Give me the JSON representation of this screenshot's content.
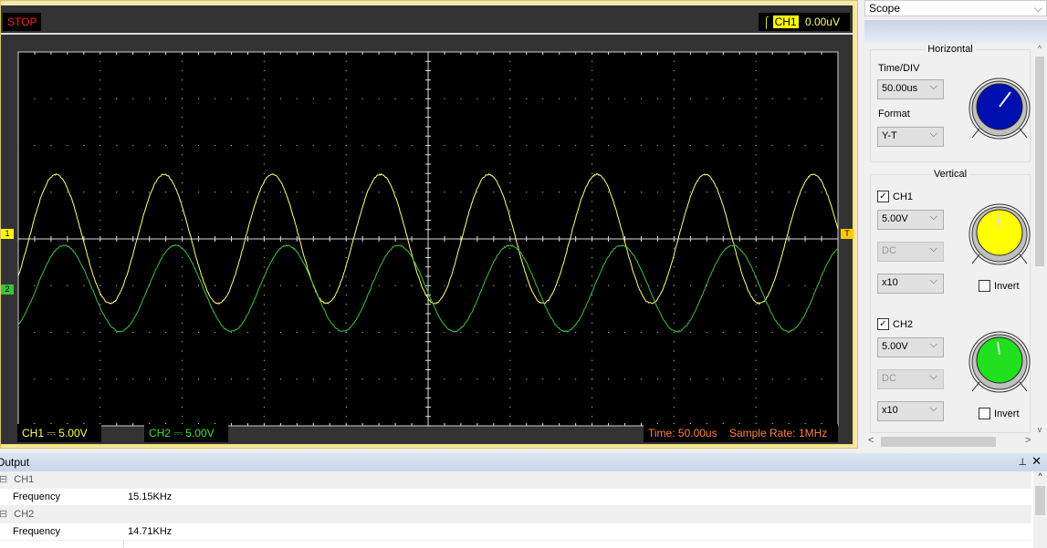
{
  "scope": {
    "status": "STOP",
    "trigger": {
      "icon": "rising-edge-trigger-icon",
      "channel": "CH1",
      "level": "0.00uV"
    },
    "ch1_label": "CH1",
    "ch1_coupling_icon": "dc-coupling-icon",
    "ch1_scale": "5.00V",
    "ch2_label": "CH2",
    "ch2_scale": "5.00V",
    "time_label": "Time: 50.00us",
    "sample_rate": "Sample Rate: 1MHz",
    "markers": {
      "ch1": "1",
      "ch2": "2",
      "trigger": "T"
    },
    "colors": {
      "ch1": "#ffff80",
      "ch2": "#40c040",
      "background": "#000000",
      "grid": "#bbbbbb",
      "status": "#ff2020",
      "info": "#ff8040"
    }
  },
  "chart_data": {
    "type": "line",
    "x_unit": "us",
    "xlim": [
      0,
      500
    ],
    "x_divisions": 10,
    "y_unit": "V",
    "ylim": [
      -20,
      20
    ],
    "y_divisions": 8,
    "grid": true,
    "series": [
      {
        "name": "CH1",
        "color": "#ffff80",
        "waveform": "sine",
        "frequency_khz": 15.15,
        "amplitude_v": 6.9,
        "offset_v": 0,
        "first_peak_us": 23
      },
      {
        "name": "CH2",
        "color": "#40c040",
        "waveform": "sine",
        "frequency_khz": 14.71,
        "amplitude_v": 4.6,
        "offset_v": -5.3,
        "first_peak_us": 28
      }
    ]
  },
  "panel": {
    "title": "Scope",
    "horizontal": {
      "title": "Horizontal",
      "time_div_label": "Time/DIV",
      "time_div": "50.00us",
      "format_label": "Format",
      "format": "Y-T",
      "knob_color": "#0010b0"
    },
    "vertical": {
      "title": "Vertical",
      "ch1": {
        "label": "CH1",
        "checked": true,
        "volts": "5.00V",
        "coupling": "DC",
        "probe": "x10",
        "invert": "Invert",
        "knob_color": "#ffff00"
      },
      "ch2": {
        "label": "CH2",
        "checked": true,
        "volts": "5.00V",
        "coupling": "DC",
        "probe": "x10",
        "invert": "Invert",
        "knob_color": "#20e020"
      }
    }
  },
  "output": {
    "title": "Output",
    "groups": [
      {
        "name": "CH1",
        "rows": [
          {
            "key": "Frequency",
            "value": "15.15KHz"
          }
        ]
      },
      {
        "name": "CH2",
        "rows": [
          {
            "key": "Frequency",
            "value": "14.71KHz"
          }
        ]
      }
    ]
  }
}
